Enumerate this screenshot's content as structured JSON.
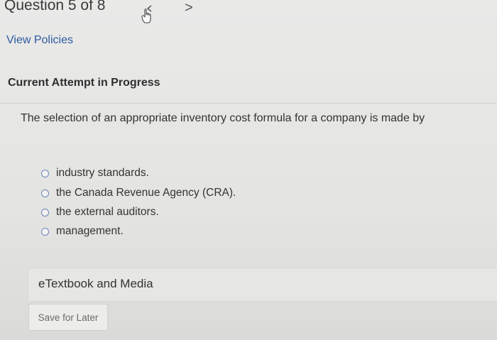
{
  "header": {
    "question_label": "Question 5 of 8",
    "next_glyph": ">"
  },
  "links": {
    "view_policies": "View Policies"
  },
  "section": {
    "title": "Current Attempt in Progress"
  },
  "question": {
    "text": "The selection of an appropriate inventory cost formula for a company is made by",
    "options": [
      {
        "label": "industry standards."
      },
      {
        "label": "the Canada Revenue Agency (CRA)."
      },
      {
        "label": "the external auditors."
      },
      {
        "label": "management."
      }
    ]
  },
  "resources": {
    "etextbook_label": "eTextbook and Media"
  },
  "actions": {
    "save_label": "Save for Later"
  },
  "colors": {
    "link": "#2c5aa0",
    "radio_border": "#6b86b8"
  }
}
